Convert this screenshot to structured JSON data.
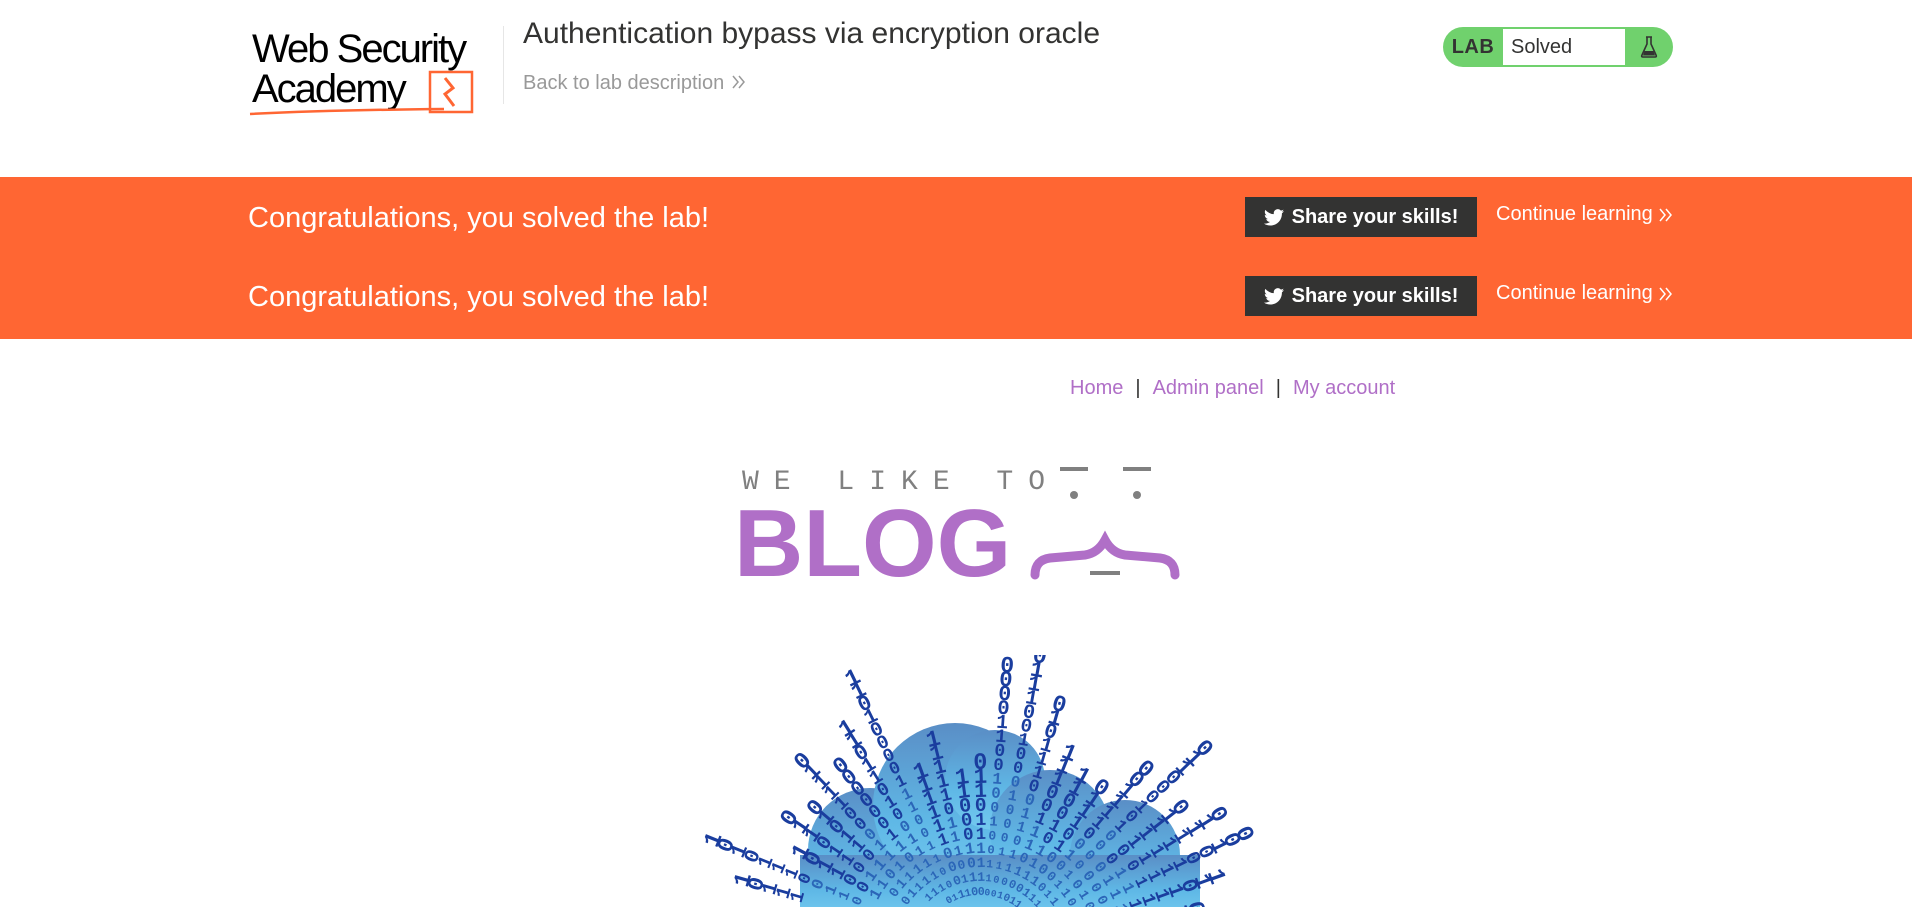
{
  "header": {
    "logo_line1": "Web Security",
    "logo_line2": "Academy",
    "lab_title": "Authentication bypass via encryption oracle",
    "back_link": "Back to lab description",
    "lab_badge": "LAB",
    "lab_status": "Solved",
    "status_icon": "flask-icon"
  },
  "banner": {
    "rows": [
      {
        "message": "Congratulations, you solved the lab!",
        "share_label": "Share your skills!",
        "continue_label": "Continue learning"
      },
      {
        "message": "Congratulations, you solved the lab!",
        "share_label": "Share your skills!",
        "continue_label": "Continue learning"
      }
    ]
  },
  "nav": {
    "home": "Home",
    "admin": "Admin panel",
    "account": "My account",
    "separator": "|"
  },
  "blog_logo": {
    "tagline": "WE LIKE TO",
    "word": "BLOG"
  },
  "colors": {
    "accent_orange": "#ff6633",
    "lab_green": "#70d16d",
    "link_purple": "#b06fc7",
    "dark": "#333332"
  }
}
